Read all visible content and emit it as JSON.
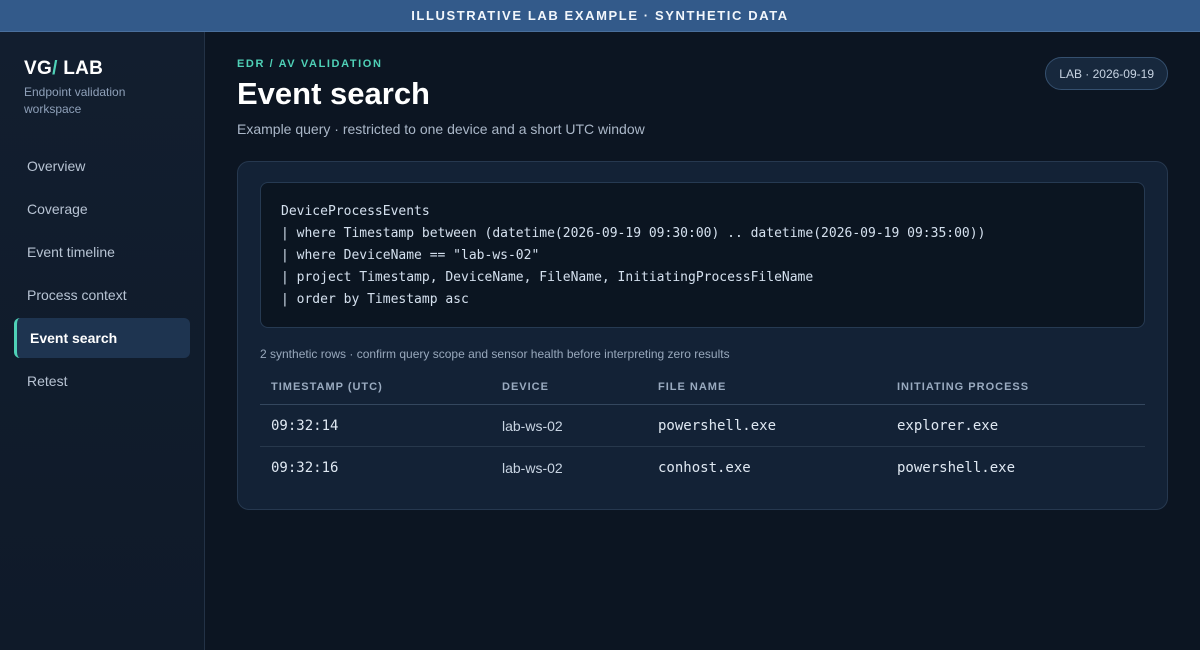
{
  "banner": {
    "text": "ILLUSTRATIVE LAB EXAMPLE · SYNTHETIC DATA"
  },
  "brand": {
    "prefix": "VG",
    "slash": "/",
    "suffix": " LAB",
    "subtitle": "Endpoint validation workspace"
  },
  "sidebar": {
    "items": [
      {
        "label": "Overview",
        "active": false
      },
      {
        "label": "Coverage",
        "active": false
      },
      {
        "label": "Event timeline",
        "active": false
      },
      {
        "label": "Process context",
        "active": false
      },
      {
        "label": "Event search",
        "active": true
      },
      {
        "label": "Retest",
        "active": false
      }
    ]
  },
  "header": {
    "eyebrow": "EDR / AV VALIDATION",
    "title": "Event search",
    "subtitle": "Example query · restricted to one device and a short UTC window",
    "badge": "LAB · 2026-09-19"
  },
  "query": {
    "lines": [
      "DeviceProcessEvents",
      "| where Timestamp between (datetime(2026-09-19 09:30:00) .. datetime(2026-09-19 09:35:00))",
      "| where DeviceName == \"lab-ws-02\"",
      "| project Timestamp, DeviceName, FileName, InitiatingProcessFileName",
      "| order by Timestamp asc"
    ]
  },
  "results": {
    "note": "2 synthetic rows · confirm query scope and sensor health before interpreting zero results",
    "columns": [
      "TIMESTAMP (UTC)",
      "DEVICE",
      "FILE NAME",
      "INITIATING PROCESS"
    ],
    "rows": [
      [
        "09:32:14",
        "lab-ws-02",
        "powershell.exe",
        "explorer.exe"
      ],
      [
        "09:32:16",
        "lab-ws-02",
        "conhost.exe",
        "powershell.exe"
      ]
    ]
  },
  "colors": {
    "accent": "#4fd1b7",
    "banner": "#335a8a",
    "background": "#0c1522",
    "card": "#132236"
  }
}
